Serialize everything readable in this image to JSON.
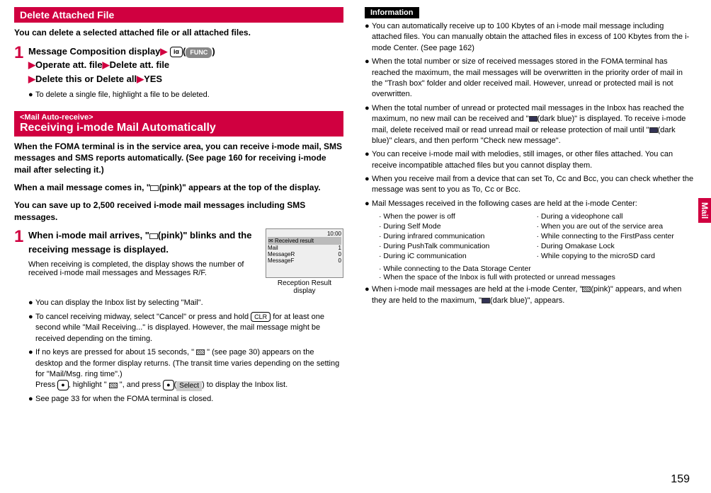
{
  "left": {
    "deleteHeader": "Delete Attached File",
    "deleteIntro": "You can delete a selected attached file or all attached files.",
    "step1": {
      "line1a": "Message Composition display",
      "key1": "iα",
      "func": "FUNC",
      "line2a": "Operate att. file",
      "line2b": "Delete att. file",
      "line3a": "Delete this or Delete all",
      "line3b": "YES",
      "bullet1": "To delete a single file, highlight a file to be deleted."
    },
    "mailAutoTag": "<Mail Auto-receive>",
    "mailAutoHeader": "Receiving i-mode Mail Automatically",
    "autoIntro1": "When the FOMA terminal is in the service area, you can receive i-mode mail, SMS messages and SMS reports automatically. (See page 160 for receiving i-mode mail after selecting it.)",
    "autoIntro2": "When a mail message comes in, \" (pink)\" appears at the top of the display.",
    "autoIntro3": "You can save up to 2,500 received i-mode mail messages including SMS messages.",
    "step2": {
      "title": "When i-mode mail arrives, \" (pink)\" blinks and the receiving message is displayed.",
      "desc": "When receiving is completed, the display shows the number of received i-mode mail messages and Messages R/F.",
      "caption": "Reception Result display",
      "b1": "You can display the Inbox list by selecting \"Mail\".",
      "b2a": "To cancel receiving midway, select \"Cancel\" or press and hold ",
      "b2key": "CLR",
      "b2b": " for at least one second while \"Mail Receiving...\" is displayed. However, the mail message might be received depending on the timing.",
      "b3a": "If no keys are pressed for about 15 seconds, \" ",
      "b3b": " \" (see page 30) appears on the desktop and the former display returns. (The transit time varies depending on the setting for \"Mail/Msg. ring time\".)",
      "b3c": "Press ",
      "b3key1": "●",
      "b3d": ", highlight \" ",
      "b3e": " \", and press ",
      "b3key2": "●",
      "b3select": "Select",
      "b3f": " to display the Inbox list.",
      "b4": "See page 33 for when the FOMA terminal is closed."
    },
    "phoneScreen": {
      "time": "10:00",
      "title": "Received result",
      "r1": "Mail",
      "r2": "MessageR",
      "r3": "MessageF",
      "v1": "1",
      "v2": "0",
      "v3": "0"
    }
  },
  "right": {
    "infoLabel": "Information",
    "b1": "You can automatically receive up to 100 Kbytes of an i-mode mail message including attached files. You can manually obtain the attached files in excess of 100 Kbytes from the i-mode Center. (See page 162)",
    "b2": "When the total number or size of received messages stored in the FOMA terminal has reached the maximum, the mail messages will be overwritten in the priority order of mail in the \"Trash box\" folder and older received mail. However, unread or protected mail is not overwritten.",
    "b3a": "When the total number of unread or protected mail messages in the Inbox has reached the maximum, no new mail can be received and \"",
    "b3b": "(dark blue)\" is displayed. To receive i-mode mail, delete received mail or read unread mail or release protection of mail until \"",
    "b3c": "(dark blue)\" clears, and then perform \"Check new message\".",
    "b4": "You can receive i-mode mail with melodies, still images, or other files attached. You can receive incompatible attached files but you cannot display them.",
    "b5": "When you receive mail from a device that can set To, Cc and Bcc, you can check whether the message was sent to you as To, Cc or Bcc.",
    "b6": "Mail Messages received in the following cases are held at the i-mode Center:",
    "list": {
      "l1": "· When the power is off",
      "l2": "· During Self Mode",
      "l3": "· During infrared communication",
      "l4": "· During PushTalk communication",
      "l5": "· During iC communication",
      "l6": "· While connecting to the Data Storage Center",
      "l7": "· When the space of the Inbox is full with protected or unread messages",
      "r1": "· During a videophone call",
      "r2": "· When you are out of the service area",
      "r3": "· While connecting to the FirstPass center",
      "r4": "· During Omakase Lock",
      "r5": "· While copying to the microSD card"
    },
    "b7a": "When i-mode mail messages are held at the i-mode Center, \"",
    "b7b": "(pink)\" appears, and when they are held to the maximum, \"",
    "b7c": "(dark blue)\", appears."
  },
  "sideTab": "Mail",
  "pageNum": "159"
}
